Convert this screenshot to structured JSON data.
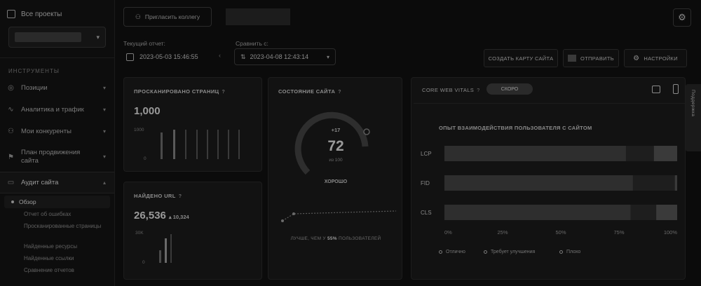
{
  "sidebar": {
    "all_projects": "Все проекты",
    "section_label": "ИНСТРУМЕНТЫ",
    "items": [
      {
        "label": "Позиции",
        "icon": "target-icon"
      },
      {
        "label": "Аналитика и трафик",
        "icon": "pulse-icon"
      },
      {
        "label": "Мои конкуренты",
        "icon": "users-icon"
      },
      {
        "label": "План продвижения сайта",
        "icon": "flag-icon"
      },
      {
        "label": "Аудит сайта",
        "icon": "monitor-icon"
      }
    ],
    "sub_items": [
      "Обзор",
      "Отчет об ошибках",
      "Просканированные страницы",
      "Найденные ресурсы",
      "Найденные ссылки",
      "Сравнение отчетов"
    ]
  },
  "topbar": {
    "invite_label": "Пригласить коллегу"
  },
  "report": {
    "current_label": "Текущий отчет:",
    "current_date": "2023-05-03 15:46:55",
    "compare_label": "Сравнить с:",
    "compare_date": "2023-04-08 12:43:14"
  },
  "actions": {
    "sitemap": "СОЗДАТЬ КАРТУ САЙТА",
    "send": "ОТПРАВИТЬ",
    "settings": "НАСТРОЙКИ"
  },
  "cards": {
    "scanned": {
      "title": "ПРОСКАНИРОВАНО СТРАНИЦ",
      "value": "1,000",
      "y_top": "1000",
      "y_bottom": "0"
    },
    "found": {
      "title": "НАЙДЕНО URL",
      "value": "26,536",
      "delta": "▴ 10,324",
      "y_top": "30K",
      "y_bottom": "0"
    },
    "health": {
      "title": "СОСТОЯНИЕ САЙТА",
      "delta": "+17",
      "score": "72",
      "unit": "из 100",
      "status": "ХОРОШО",
      "footer_pre": "ЛУЧШЕ, ЧЕМ У",
      "footer_pct": "55%",
      "footer_post": "ПОЛЬЗОВАТЕЛЕЙ"
    }
  },
  "cwv": {
    "tab": "CORE WEB VITALS",
    "pill": "СКОРО",
    "chart_title": "ОПЫТ ВЗАИМОДЕЙСТВИЯ ПОЛЬЗОВАТЕЛЯ С САЙТОМ",
    "side_tab": "Поддержка"
  },
  "chart_data": {
    "type": "bar",
    "orientation": "horizontal",
    "stacked": true,
    "title": "ОПЫТ ВЗАИМОДЕЙСТВИЯ ПОЛЬЗОВАТЕЛЯ С САЙТОМ",
    "categories": [
      "LCP",
      "FID",
      "CLS"
    ],
    "series": [
      {
        "name": "Отлично",
        "values": [
          78,
          81,
          80
        ]
      },
      {
        "name": "Требует улучшения",
        "values": [
          12,
          18,
          11
        ]
      },
      {
        "name": "Плохо",
        "values": [
          10,
          1,
          9
        ]
      }
    ],
    "xticks": [
      "0%",
      "25%",
      "50%",
      "75%",
      "100%"
    ],
    "xlim": [
      0,
      100
    ],
    "legend": [
      "Отлично",
      "Требует улучшения",
      "Плохо"
    ],
    "legend_position": "bottom"
  }
}
